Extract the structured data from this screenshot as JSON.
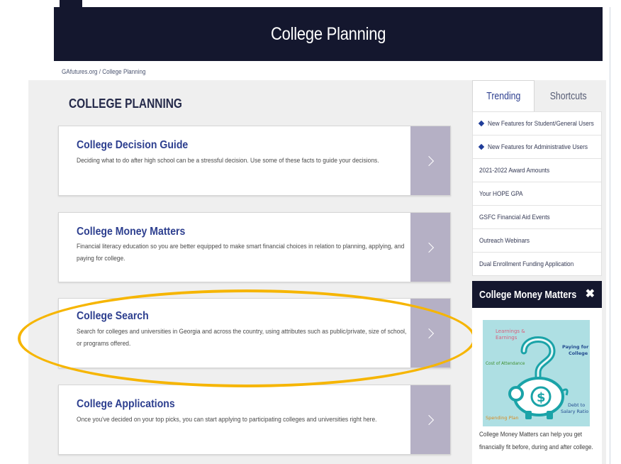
{
  "header": {
    "title": "College Planning"
  },
  "breadcrumb": {
    "home": "GAfutures.org",
    "separator": "/",
    "current": "College Planning"
  },
  "main": {
    "section_title": "COLLEGE PLANNING",
    "cards": [
      {
        "title": "College Decision Guide",
        "description": "Deciding what to do after high school can be a stressful decision. Use some of these facts to guide your decisions."
      },
      {
        "title": "College Money Matters",
        "description": "Financial literacy education so you are better equipped to make smart financial choices in relation to planning, applying, and paying for college."
      },
      {
        "title": "College Search",
        "description": "Search for colleges and universities in Georgia and across the country, using attributes such as public/private, size of school, or programs offered."
      },
      {
        "title": "College Applications",
        "description": "Once you've decided on your top picks, you can start applying to participating colleges and universities right here."
      }
    ]
  },
  "sidebar": {
    "tabs": {
      "trending": "Trending",
      "shortcuts": "Shortcuts"
    },
    "trending_items": [
      {
        "label": "New Features for Student/General Users",
        "bullet": true
      },
      {
        "label": "New Features for Administrative Users",
        "bullet": true
      },
      {
        "label": "2021-2022 Award Amounts",
        "bullet": false
      },
      {
        "label": "Your HOPE GPA",
        "bullet": false
      },
      {
        "label": "GSFC Financial Aid Events",
        "bullet": false
      },
      {
        "label": "Outreach Webinars",
        "bullet": false
      },
      {
        "label": "Dual Enrollment Funding Application",
        "bullet": false
      }
    ],
    "money_matters": {
      "title": "College Money Matters",
      "close_glyph": "✖",
      "image_labels": {
        "learnings": "Learnings &",
        "earnings": "Earnings",
        "paying": "Paying for",
        "college": "College",
        "cost": "Cost of Attendance",
        "debt": "Debt to",
        "salary": "Salary Ratio",
        "spending": "Spending Plan",
        "dollar": "$"
      },
      "caption": "College Money Matters can help you get financially fit before, during and after college."
    }
  },
  "colors": {
    "navy": "#14172e",
    "title_blue": "#2d3f8f",
    "arrow_purple": "#b5b0c5",
    "highlight": "#f6b500",
    "teal": "#1aa3a8"
  }
}
